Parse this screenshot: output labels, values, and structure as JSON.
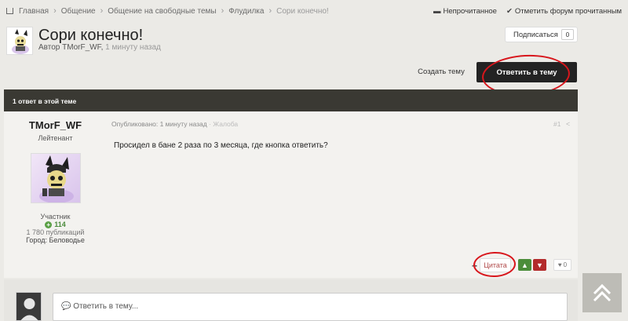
{
  "breadcrumb": {
    "items": [
      "Главная",
      "Общение",
      "Общение на свободные темы",
      "Флудилка"
    ],
    "current": "Сори конечно!"
  },
  "top_actions": {
    "unread": "Непрочитанное",
    "mark_read": "Отметить форум прочитанным"
  },
  "topic": {
    "title": "Сори конечно!",
    "author_prefix": "Автор TMorF_WF,",
    "time": "1 минуту назад",
    "follow_label": "Подписаться",
    "follow_count": "0"
  },
  "buttons": {
    "create": "Создать тему",
    "reply": "Ответить в тему"
  },
  "thread": {
    "count_label": "1 ответ в этой теме"
  },
  "post": {
    "author": "TMorF_WF",
    "rank": "Лейтенант",
    "group": "Участник",
    "reputation": "114",
    "posts_count": "1 780 публикаций",
    "city": "Город: Беловодье",
    "published": "Опубликовано: 1 минуту назад",
    "report": "· Жалоба",
    "number": "#1",
    "text": "Просидел в бане 2 раза по 3 месяца, где кнопка ответить?",
    "quote_label": "Цитата",
    "likes": "0"
  },
  "reply_box": {
    "placeholder": "Ответить в тему..."
  },
  "colors": {
    "accent_dark": "#232323",
    "bar": "#3a3933",
    "upvote": "#4b8d3a",
    "downvote": "#b32b2b",
    "annotation": "#d8161c"
  }
}
